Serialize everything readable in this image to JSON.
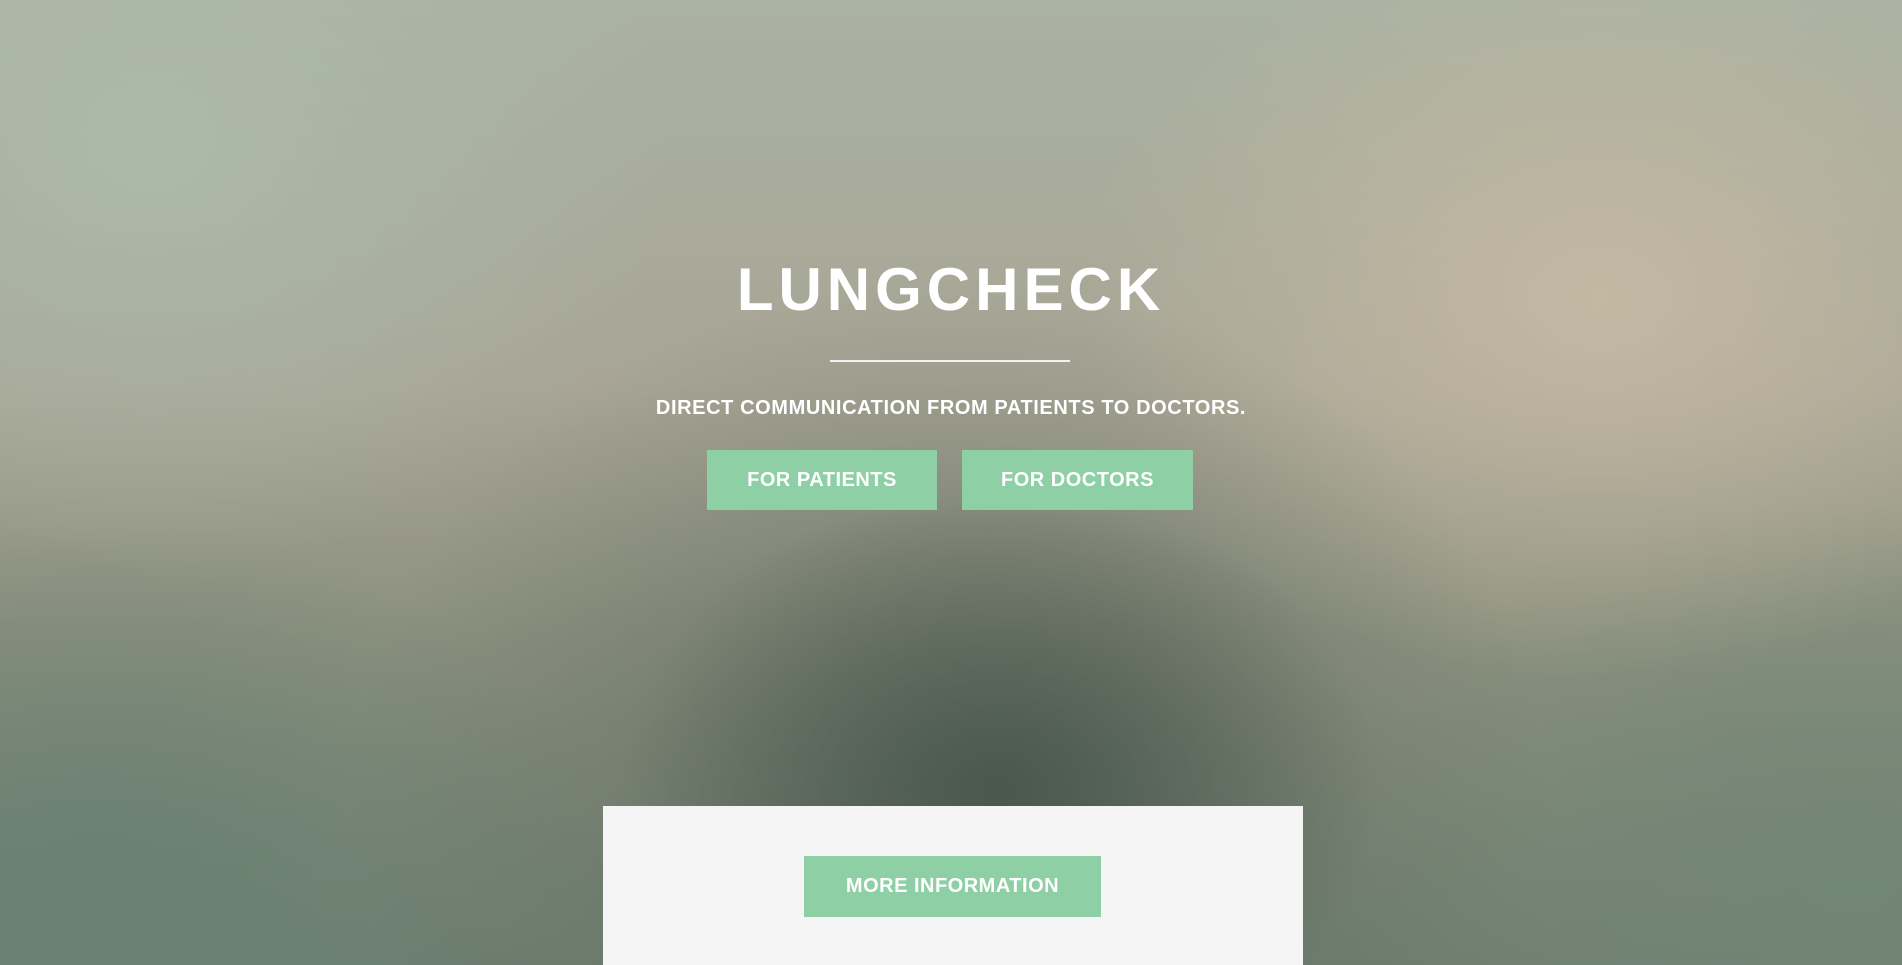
{
  "hero": {
    "title": "LUNGCHECK",
    "subtitle": "DIRECT COMMUNICATION FROM PATIENTS TO DOCTORS.",
    "buttons": {
      "patients_label": "FOR PATIENTS",
      "doctors_label": "FOR DOCTORS"
    }
  },
  "info_panel": {
    "more_info_label": "MORE INFORMATION"
  },
  "colors": {
    "accent": "#8ecfa6",
    "text": "#ffffff",
    "panel": "#f5f5f5"
  }
}
